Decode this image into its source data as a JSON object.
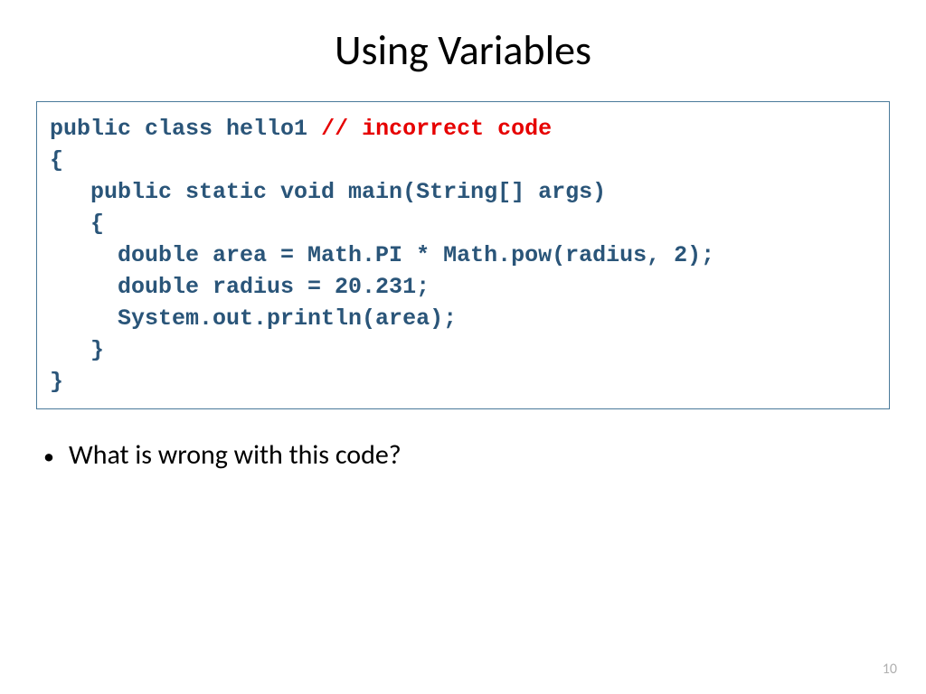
{
  "title": "Using Variables",
  "code": {
    "line1a": "public class hello1 ",
    "line1b": "// incorrect code",
    "line2": "{",
    "line3": "   public static void main(String[] args)",
    "line4": "   {",
    "line5": "     double area = Math.PI * Math.pow(radius, 2);",
    "line6": "     double radius = 20.231;",
    "line7": "     System.out.println(area);",
    "line8": "   }",
    "line9": "}"
  },
  "bullet": "What is wrong with this code?",
  "page_number": "10"
}
